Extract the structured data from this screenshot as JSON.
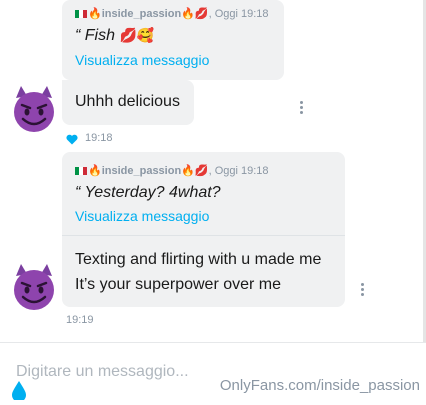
{
  "colors": {
    "bubble": "#f0f1f2",
    "link": "#00aff0",
    "meta": "#8a96a3",
    "accent_heart": "#00aff0"
  },
  "messages": [
    {
      "quote": {
        "sender": "inside_passion",
        "time": "Oggi 19:18",
        "text": "“ Fish",
        "text_emoji": "💋🥰",
        "link": "Visualizza messaggio"
      },
      "text": "Uhhh delicious",
      "time": "19:18",
      "liked": true
    },
    {
      "quote": {
        "sender": "inside_passion",
        "time": "Oggi 19:18",
        "text": "“ Yesterday? 4what?",
        "link": "Visualizza messaggio"
      },
      "lines": [
        "Texting and flirting with u made me",
        "It’s your superpower over me"
      ],
      "time": "19:19"
    }
  ],
  "composer": {
    "placeholder": "Digitare un messaggio..."
  },
  "watermark": "OnlyFans.com/inside_passion",
  "icons": {
    "avatar": "smiling-devil-icon",
    "more": "kebab-menu-icon",
    "like": "heart-icon"
  }
}
